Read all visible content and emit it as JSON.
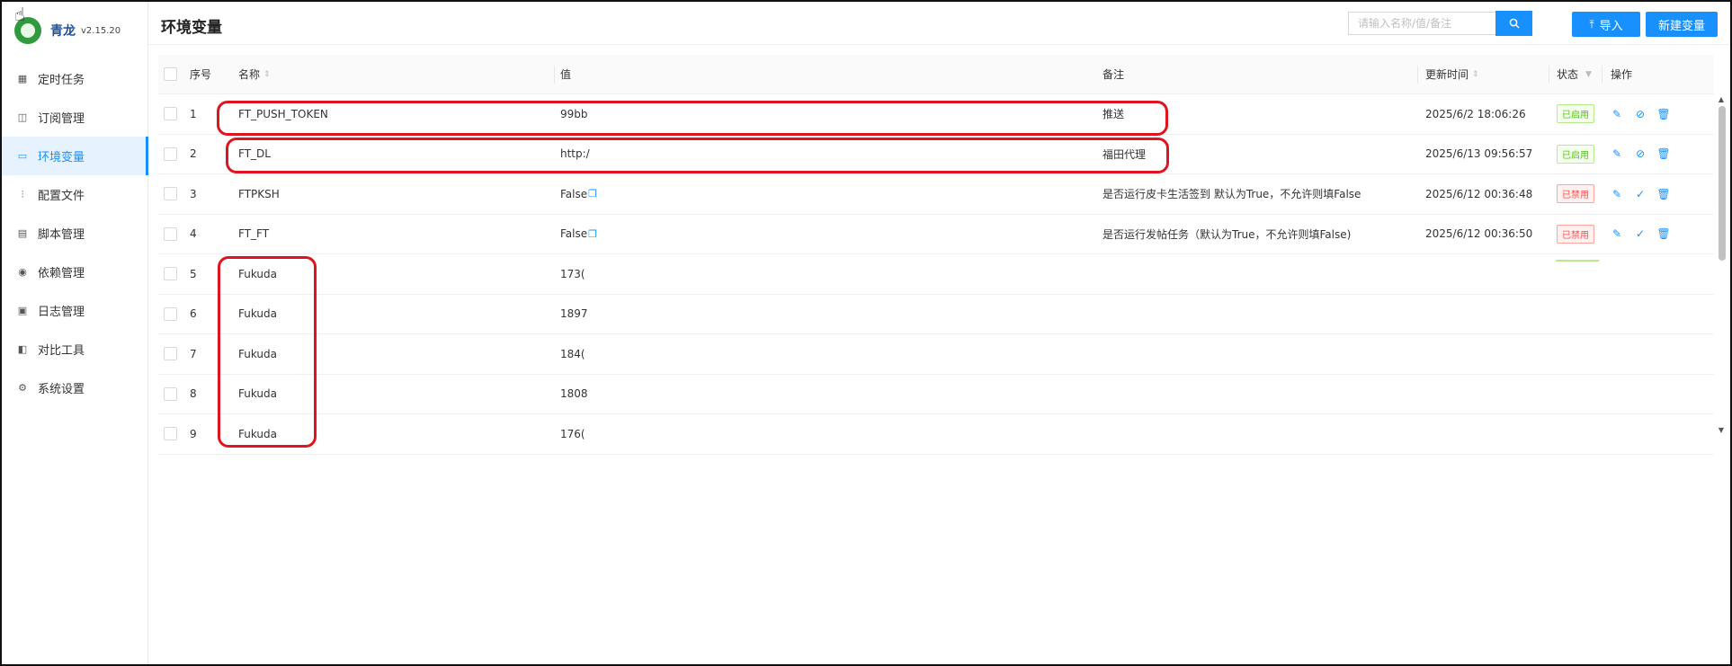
{
  "app": {
    "name": "青龙",
    "version": "v2.15.20"
  },
  "sidebar": {
    "items": [
      {
        "label": "定时任务",
        "icon": "calendar-icon",
        "glyph": "▦"
      },
      {
        "label": "订阅管理",
        "icon": "subscription-icon",
        "glyph": "◫"
      },
      {
        "label": "环境变量",
        "icon": "monitor-icon",
        "glyph": "▭",
        "active": true
      },
      {
        "label": "配置文件",
        "icon": "sliders-icon",
        "glyph": "⫶"
      },
      {
        "label": "脚本管理",
        "icon": "script-icon",
        "glyph": "▤"
      },
      {
        "label": "依赖管理",
        "icon": "dependency-icon",
        "glyph": "◉"
      },
      {
        "label": "日志管理",
        "icon": "log-icon",
        "glyph": "▣"
      },
      {
        "label": "对比工具",
        "icon": "diff-icon",
        "glyph": "◧"
      },
      {
        "label": "系统设置",
        "icon": "settings-icon",
        "glyph": "⚙"
      }
    ]
  },
  "header": {
    "title": "环境变量",
    "search_placeholder": "请输入名称/值/备注",
    "import_label": "导入",
    "new_label": "新建变量"
  },
  "table": {
    "columns": {
      "index": "序号",
      "name": "名称",
      "value": "值",
      "remark": "备注",
      "updated": "更新时间",
      "status": "状态",
      "ops": "操作"
    },
    "rows": [
      {
        "index": "1",
        "name": "FT_PUSH_TOKEN",
        "value": "99bb",
        "remark": "推送",
        "updated": "2025/6/2 18:06:26",
        "status": "已启用",
        "enabled": true
      },
      {
        "index": "2",
        "name": "FT_DL",
        "value": "http:/",
        "remark": "福田代理",
        "updated": "2025/6/13 09:56:57",
        "status": "已启用",
        "enabled": true
      },
      {
        "index": "3",
        "name": "FTPKSH",
        "value": "False",
        "remark": "是否运行皮卡生活签到 默认为True，不允许则填False",
        "updated": "2025/6/12 00:36:48",
        "status": "已禁用",
        "enabled": false
      },
      {
        "index": "4",
        "name": "FT_FT",
        "value": "False",
        "remark": "是否运行发帖任务（默认为True，不允许则填False)",
        "updated": "2025/6/12 00:36:50",
        "status": "已禁用",
        "enabled": false
      },
      {
        "index": "5",
        "name": "Fukuda",
        "value": "173("
      },
      {
        "index": "6",
        "name": "Fukuda",
        "value": "1897"
      },
      {
        "index": "7",
        "name": "Fukuda",
        "value": "184("
      },
      {
        "index": "8",
        "name": "Fukuda",
        "value": "1808"
      },
      {
        "index": "9",
        "name": "Fukuda",
        "value": "176("
      }
    ]
  },
  "colors": {
    "accent": "#1890ff",
    "enabled": "#52c41a",
    "disabled": "#ff4d4f",
    "highlight": "#e0141e"
  }
}
